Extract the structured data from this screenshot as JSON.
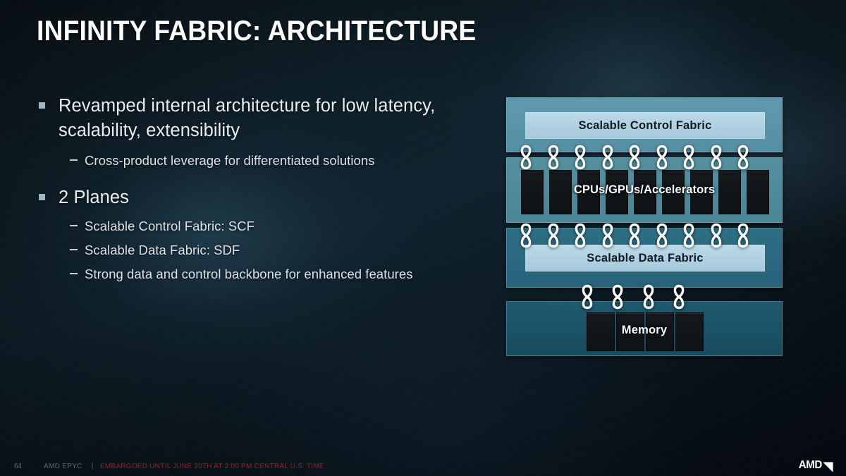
{
  "slide": {
    "title": "INFINITY FABRIC: ARCHITECTURE",
    "accent_light": "#a5c9dc",
    "panel_blue": "#5b96aa",
    "panel_teal": "#2a687d",
    "panel_dark_teal": "#1b5468",
    "block_dark": "#121618",
    "text_color": "#e9eef2"
  },
  "bullets": {
    "b1": {
      "text": "Revamped internal architecture for low latency, scalability, extensibility",
      "sub": [
        "Cross-product leverage for differentiated solutions"
      ]
    },
    "b2": {
      "text": "2 Planes",
      "sub": [
        "Scalable Control Fabric: SCF",
        "Scalable Data Fabric: SDF",
        "Strong data and control backbone for enhanced features"
      ]
    }
  },
  "diagram": {
    "name": "infinity-fabric-architecture",
    "panels": [
      {
        "id": "scf",
        "label": "Scalable Control Fabric",
        "kind": "fabric-bar"
      },
      {
        "id": "compute",
        "label": "CPUs/GPUs/Accelerators",
        "kind": "block-row",
        "block_count": 9
      },
      {
        "id": "sdf",
        "label": "Scalable Data Fabric",
        "kind": "fabric-bar"
      },
      {
        "id": "memory",
        "label": "Memory",
        "kind": "block-row",
        "block_count": 4
      }
    ],
    "link_rows": [
      {
        "id": "links-top",
        "count": 9,
        "icon": "infinity-link-icon"
      },
      {
        "id": "links-mid",
        "count": 9,
        "icon": "infinity-link-icon"
      },
      {
        "id": "links-bottom",
        "count": 4,
        "icon": "infinity-link-icon"
      }
    ]
  },
  "footer": {
    "page": "64",
    "product": "AMD EPYC",
    "separator": "|",
    "embargo": "EMBARGOED UNTIL JUNE 20TH AT 3:00 PM CENTRAL U.S. TIME",
    "logo": "AMD"
  }
}
